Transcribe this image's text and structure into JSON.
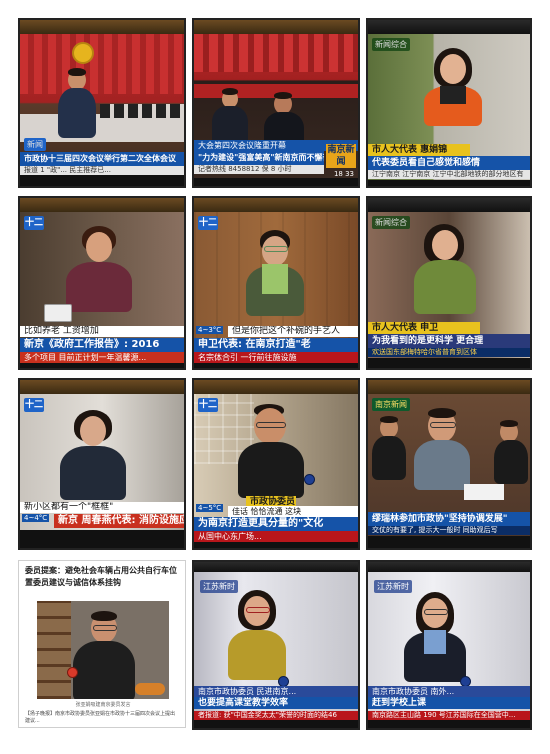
{
  "tiles": {
    "t1": {
      "channel": "新闻",
      "caption_main": "市政协十三届四次会议举行第二次全体会议",
      "ticker": "报道 1 \"政\"... 民主推荐已..."
    },
    "t2": {
      "caption_top": "大会第四次会议隆重开幕",
      "caption_main": "\"力为建设\"强富美高\"新南京而不懈奋斗",
      "caption_sub": "记者热线 8458812 保 8 小时",
      "clock": "18 33",
      "brand": "南京新闻"
    },
    "t3": {
      "channel": "新闻综合",
      "cap_name": "市人大代表 惠娟锦",
      "caption_main": "代表委员看自己感觉和感情",
      "ticker": "江宁南京 江宁南京 江宁中北部地铁的部分地区有"
    },
    "t4": {
      "channel": "十二",
      "caption_sub": "比如养老 工资增加",
      "caption_main": "新京《政府工作报告》: 2016",
      "ticker": "多个项目 目前正计划一年温馨源..."
    },
    "t5": {
      "channel": "十二",
      "weather": "4~3°C",
      "caption_sub": "但是你把这个补碗的手艺人",
      "caption_main": "申卫代表: 在南京打造\"老",
      "ticker": "名宗体合引 一行前往施设施"
    },
    "t6": {
      "channel": "新闻综合",
      "cap_name": "市人大代表 申卫",
      "caption_main": "为我看到的是更科学 更合理",
      "ticker": "欢送国东部梅特哈尔省普育到区体"
    },
    "t7": {
      "channel": "十二",
      "weather": "4~4°C",
      "caption_sub": "新小区都有一个\"框框\"",
      "caption_main": "新京 周春燕代表: 消防设施应适合入"
    },
    "t8": {
      "channel": "十二",
      "weather": "4~5°C",
      "cap_name": "市政协委员",
      "caption_sub": "佳话 恰恰流通 这块",
      "caption_main": "为南京打造更具分量的\"文化",
      "ticker": "从国中心东广场..."
    },
    "t9": {
      "channel": "南京新闻",
      "caption_main": "缪瑞林参加市政协\"坚持协调发展\"",
      "ticker": "交仗的有要了, 提示大一般时 同助观后写"
    },
    "article": {
      "title": "委员提案：避免社会车辆占用公共自行车位置委员建议与诚信体系挂钩",
      "photo_caption": "张亚娟吸建南京委员发言",
      "body": "【扬子晚报】南京市政协委员张亚娟在市政协十三届四次会议上提出建议..."
    },
    "t11": {
      "channel": "江苏新时",
      "cap_name": "南京市政协委员 民进南京...",
      "caption_main": "也要提高课堂教学效率",
      "ticker": "者报道: 获\"中国金奖太太\"荣誉的时面的结46"
    },
    "t12": {
      "channel": "江苏新时",
      "cap_name": "南京市政协委员 南外...",
      "caption_main": "赶到学校上课",
      "ticker": "南京路区主山路 190 号江苏国际在全国营中..."
    }
  }
}
